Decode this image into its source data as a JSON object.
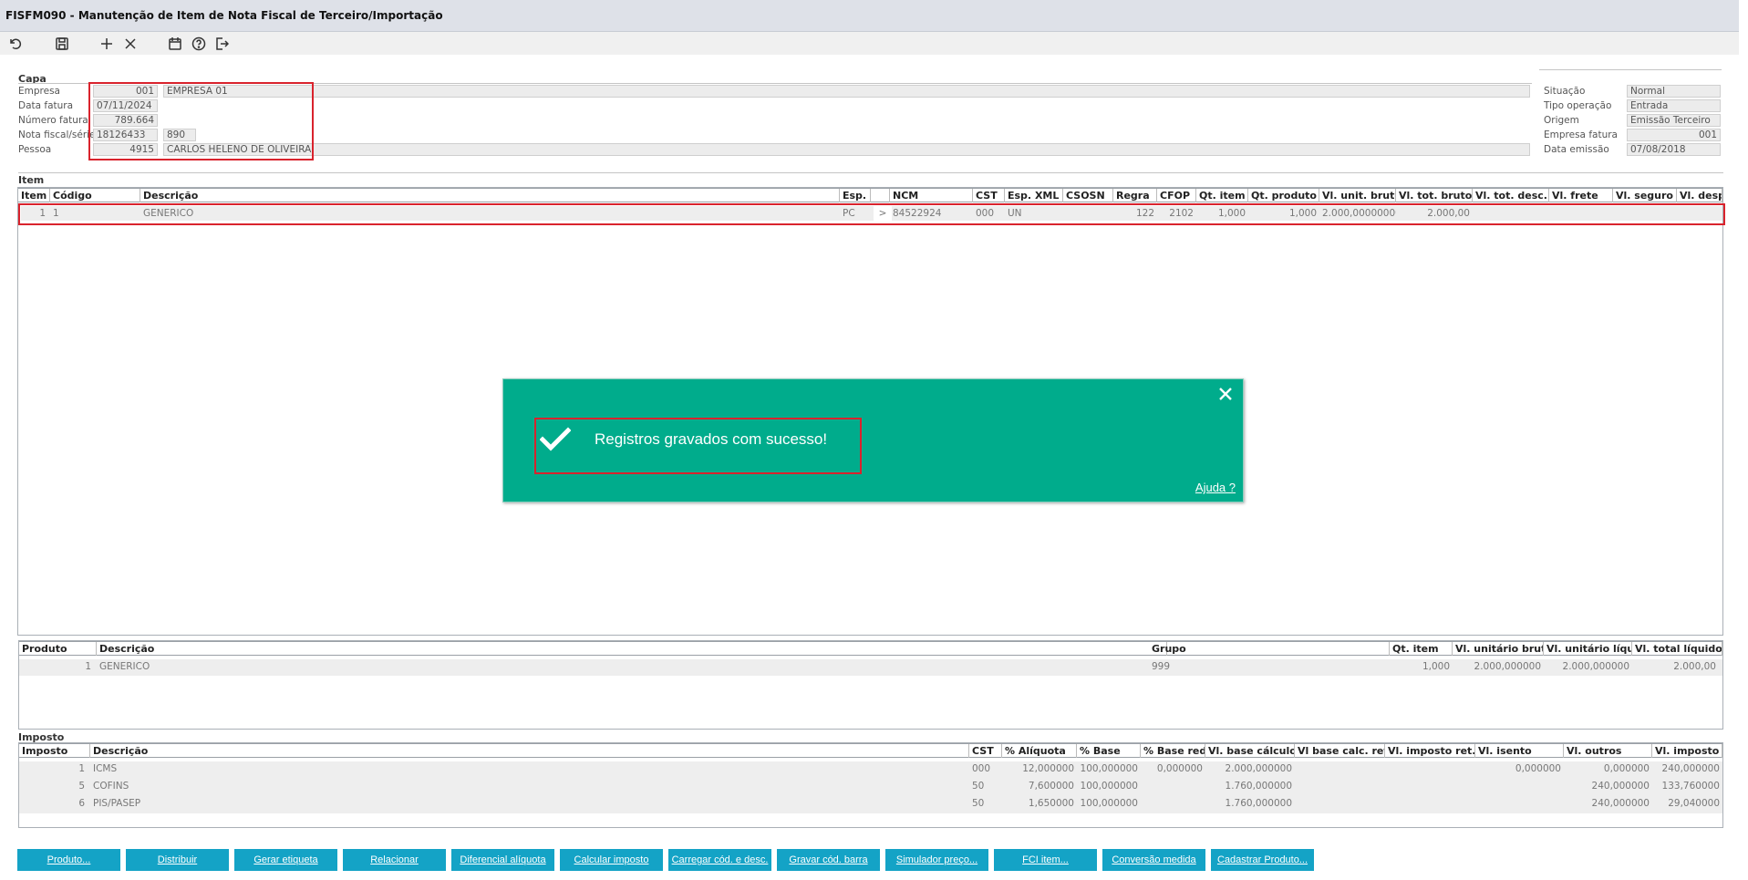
{
  "window": {
    "title": "FISFM090 - Manutenção de Item de Nota Fiscal de Terceiro/Importação"
  },
  "toolbar": {
    "icons": [
      "undo-icon",
      "save-icon",
      "add-icon",
      "delete-icon",
      "calendar-icon",
      "help-icon",
      "exit-icon"
    ]
  },
  "capa": {
    "label": "Capa",
    "empresa_label": "Empresa",
    "empresa_code": "001",
    "empresa_name": "EMPRESA 01",
    "data_fatura_label": "Data fatura",
    "data_fatura": "07/11/2024",
    "numero_fatura_label": "Número fatura",
    "numero_fatura": "789.664",
    "nf_serie_label": "Nota fiscal/série",
    "nf": "18126433",
    "serie": "890",
    "pessoa_label": "Pessoa",
    "pessoa_code": "4915",
    "pessoa_name": "CARLOS HELENO DE OLIVEIRA",
    "situacao_label": "Situação",
    "situacao": "Normal",
    "tipo_op_label": "Tipo operação",
    "tipo_op": "Entrada",
    "origem_label": "Origem",
    "origem": "Emissão Terceiro",
    "empresa_fatura_label": "Empresa fatura",
    "empresa_fatura": "001",
    "data_emissao_label": "Data emissão",
    "data_emissao": "07/08/2018"
  },
  "item": {
    "label": "Item",
    "headers": [
      "Item",
      "Código",
      "Descrição",
      "Esp.",
      "",
      "NCM",
      "CST",
      "Esp. XML",
      "CSOSN",
      "Regra",
      "CFOP",
      "Qt. item",
      "Qt. produto",
      "Vl. unit. bruto",
      "Vl. tot. bruto",
      "Vl. tot. desc.",
      "Vl. frete",
      "Vl. seguro",
      "Vl. desp. ac."
    ],
    "row": [
      "1",
      "1",
      "GENERICO",
      "PC",
      ">",
      "84522924",
      "000",
      "UN",
      "",
      "122",
      "2102",
      "1,000",
      "1,000",
      "2.000,00000000",
      "2.000,00",
      "",
      "",
      "",
      ""
    ]
  },
  "produto": {
    "headers": [
      "Produto",
      "Descrição",
      "Grupo",
      "Qt. item",
      "Vl. unitário bruto",
      "Vl. unitário líquido",
      "Vl. total líquido"
    ],
    "row": [
      "1",
      "GENERICO",
      "999",
      "1,000",
      "2.000,000000",
      "2.000,000000",
      "2.000,00"
    ]
  },
  "imposto": {
    "label": "Imposto",
    "headers": [
      "Imposto",
      "Descrição",
      "CST",
      "% Alíquota",
      "% Base",
      "% Base red.",
      "Vl. base cálculo",
      "Vl base calc. ret.",
      "Vl. imposto ret.",
      "Vl. isento",
      "Vl. outros",
      "Vl. imposto"
    ],
    "rows": [
      [
        "1",
        "ICMS",
        "000",
        "12,000000",
        "100,000000",
        "0,000000",
        "2.000,000000",
        "",
        "",
        "0,000000",
        "0,000000",
        "240,000000"
      ],
      [
        "5",
        "COFINS",
        "50",
        "7,600000",
        "100,000000",
        "",
        "1.760,000000",
        "",
        "",
        "",
        "240,000000",
        "133,760000"
      ],
      [
        "6",
        "PIS/PASEP",
        "50",
        "1,650000",
        "100,000000",
        "",
        "1.760,000000",
        "",
        "",
        "",
        "240,000000",
        "29,040000"
      ]
    ]
  },
  "toast": {
    "message": "Registros gravados com sucesso!",
    "help": "Ajuda ?",
    "color": "#00ac8c"
  },
  "buttons": [
    "Produto...",
    "Distribuir",
    "Gerar etiqueta",
    "Relacionar",
    "Diferencial alíquota",
    "Calcular imposto",
    "Carregar cód. e desc.",
    "Gravar cód. barra",
    "Simulador preço...",
    "FCI item...",
    "Conversão medida",
    "Cadastrar Produto..."
  ],
  "colors": {
    "button": "#14a3c6",
    "highlight": "#d9232d"
  }
}
